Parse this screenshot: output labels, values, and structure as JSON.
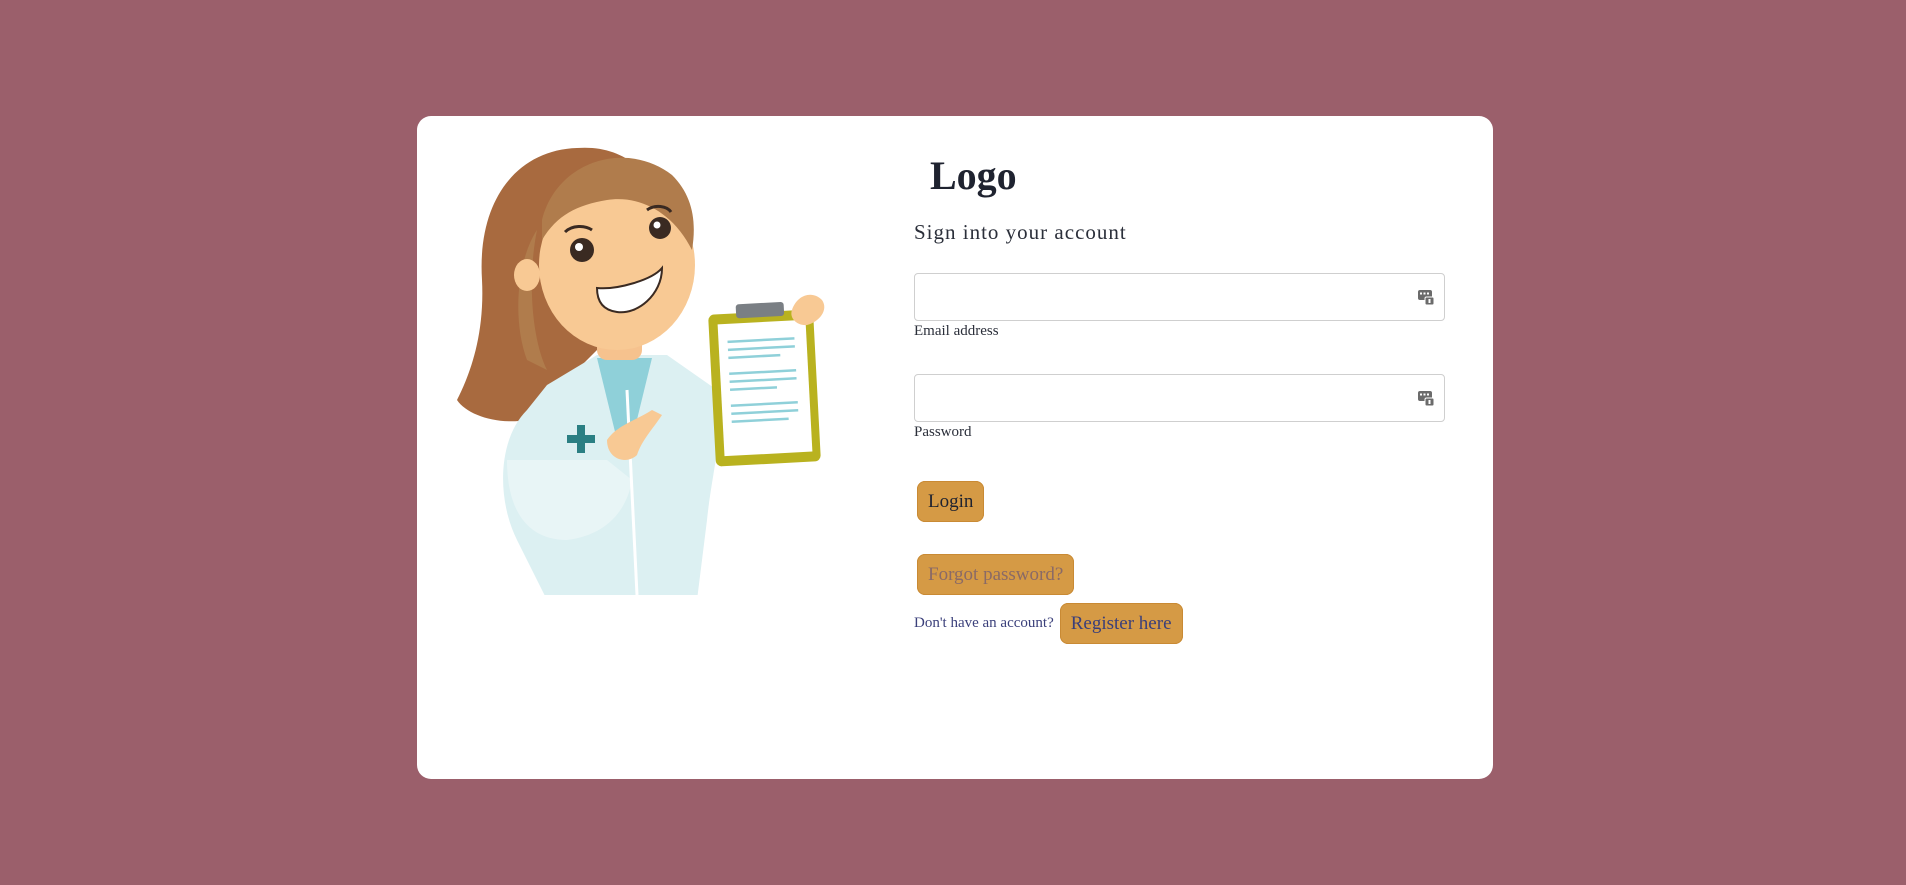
{
  "logo": "Logo",
  "subtitle": "Sign into your account",
  "email": {
    "label": "Email address",
    "value": "",
    "icon": "password-manager-icon"
  },
  "password": {
    "label": "Password",
    "value": "",
    "icon": "password-manager-icon"
  },
  "buttons": {
    "login": "Login",
    "forgot": "Forgot password?",
    "register": "Register here"
  },
  "register_prompt": "Don't have an account?",
  "colors": {
    "background": "#9b5f6b",
    "card": "#ffffff",
    "button": "#d59a45",
    "link_text": "#3a3f7a"
  },
  "illustration": "doctor-with-clipboard-illustration"
}
